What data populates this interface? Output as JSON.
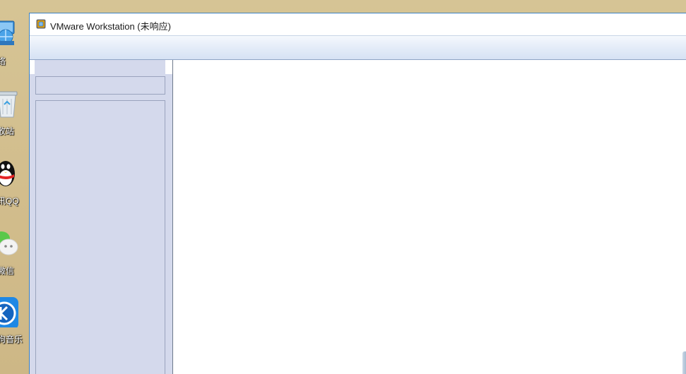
{
  "window": {
    "title": "VMware Workstation (未响应)",
    "icon": "vmware-logo-icon"
  },
  "desktop": {
    "icons": [
      {
        "label": "网络",
        "icon": "network-icon"
      },
      {
        "label": "回收站",
        "icon": "recycle-bin-icon"
      },
      {
        "label": "腾讯QQ",
        "icon": "qq-penguin-icon"
      },
      {
        "label": "微信",
        "icon": "wechat-icon"
      },
      {
        "label": "酷狗音乐",
        "icon": "kugou-music-icon"
      }
    ],
    "visible_labels": [
      "络",
      "收站",
      "讯QQ",
      "微信",
      "狗音乐"
    ]
  },
  "colors": {
    "desktop": "#d3bf8f",
    "window_border": "#3c82c2",
    "sidebar": "#d4d9ec"
  }
}
